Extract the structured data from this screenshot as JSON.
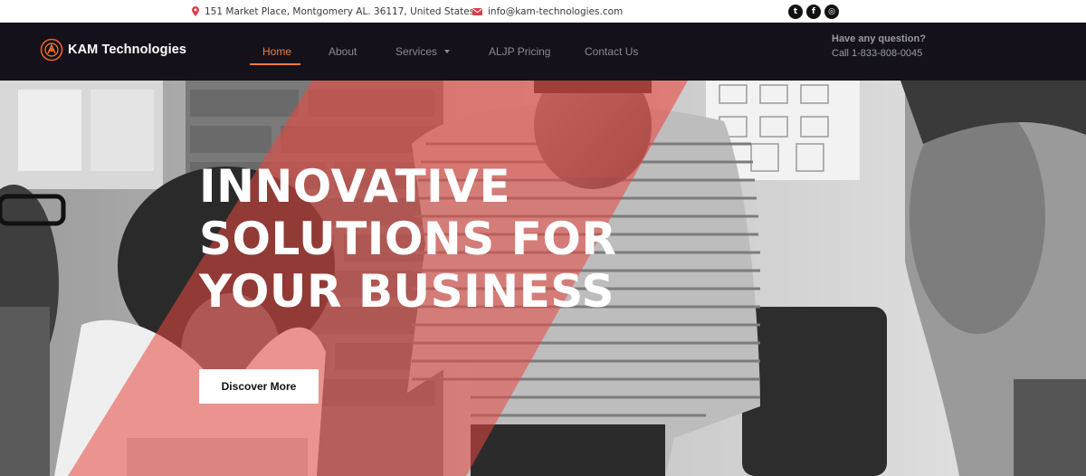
{
  "topbar": {
    "address": "151 Market Place, Montgomery AL. 36117, United States",
    "email": "info@kam-technologies.com",
    "socials": [
      {
        "icon": "twitter-icon",
        "glyph": "t"
      },
      {
        "icon": "facebook-icon",
        "glyph": "f"
      },
      {
        "icon": "instagram-icon",
        "glyph": "◎"
      }
    ]
  },
  "brand": {
    "name": "KAM Technologies",
    "accent": "#f47c38",
    "nav_bg": "#14111a"
  },
  "nav": {
    "items": [
      {
        "label": "Home",
        "active": true
      },
      {
        "label": "About",
        "active": false
      },
      {
        "label": "Services",
        "active": false,
        "has_dropdown": true
      },
      {
        "label": "ALJP Pricing",
        "active": false
      },
      {
        "label": "Contact Us",
        "active": false
      }
    ]
  },
  "contact": {
    "question": "Have any question?",
    "phone": "Call 1-833-808-0045"
  },
  "hero": {
    "headline_lines": [
      "INNOVATIVE",
      "SOLUTIONS FOR",
      "YOUR BUSINESS"
    ],
    "cta_label": "Discover More"
  }
}
